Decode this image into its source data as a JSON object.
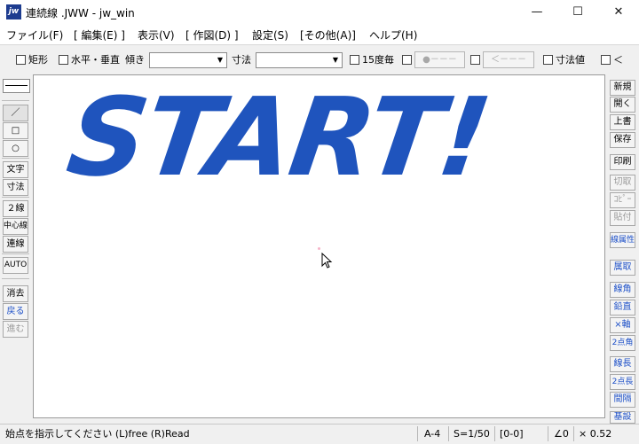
{
  "window": {
    "app_icon": "jw",
    "title": "連続線 .JWW - jw_win",
    "minimize_glyph": "—",
    "maximize_glyph": "☐",
    "close_glyph": "✕"
  },
  "menu": [
    "ファイル(F)",
    "[ 編集(E) ]",
    "表示(V)",
    "[ 作図(D) ]",
    "設定(S)",
    "[その他(A)]",
    "ヘルプ(H)"
  ],
  "toolbar": {
    "rect_label": "矩形",
    "hv_label": "水平・垂直",
    "slope_label": "傾き",
    "slope_value": "",
    "dim_label": "寸法",
    "dim_value": "",
    "angle15_label": "15度毎",
    "btn1_label": "●－－－",
    "btn2_label": "＜－－－",
    "dimval_label": "寸法値",
    "last_label": "＜",
    "combo_arrow": "▼"
  },
  "left_tools": [
    "／",
    "□",
    "○",
    "文字",
    "寸法",
    "２線",
    "中心線",
    "連線",
    "AUTO",
    "消去",
    "戻る",
    "進む"
  ],
  "right_tools": [
    "新規",
    "開く",
    "上書",
    "保存",
    "印刷",
    "切取",
    "ｺﾋﾟｰ",
    "貼付",
    "線属性",
    "属取",
    "線角",
    "鉛直",
    "×軸",
    "2点角",
    "線長",
    "2点長",
    "間隔",
    "基設"
  ],
  "canvas": {
    "text": "START!"
  },
  "status": {
    "message": "始点を指示してください (L)free (R)Read",
    "paper": "A-4",
    "scale": "S=1/50",
    "layer": "[0-0]",
    "angle": "∠0",
    "factor": "× 0.52"
  },
  "colors": {
    "accent": "#1f54bd",
    "canvas_bg": "#ffffff",
    "chrome": "#f0f0f0"
  }
}
